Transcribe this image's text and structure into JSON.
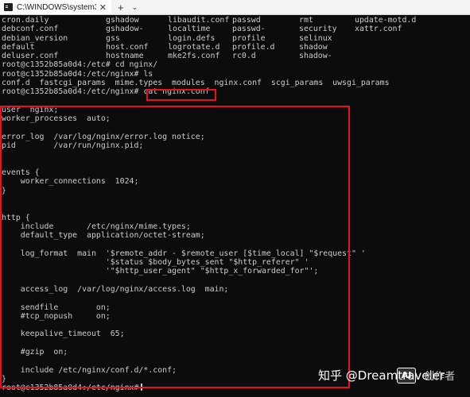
{
  "window": {
    "tab_title": "C:\\WINDOWS\\system32\\cmd.e",
    "close_glyph": "✕",
    "add_glyph": "+",
    "dropdown_glyph": "⌄",
    "icon": "terminal-icon"
  },
  "ls_rows": [
    [
      "cron.daily",
      "gshadow",
      "libaudit.conf",
      "passwd",
      "rmt",
      "update-motd.d"
    ],
    [
      "debconf.conf",
      "gshadow-",
      "localtime",
      "passwd-",
      "security",
      "xattr.conf"
    ],
    [
      "debian_version",
      "gss",
      "login.defs",
      "profile",
      "selinux",
      ""
    ],
    [
      "default",
      "host.conf",
      "logrotate.d",
      "profile.d",
      "shadow",
      ""
    ],
    [
      "deluser.conf",
      "hostname",
      "mke2fs.conf",
      "rc0.d",
      "shadow-",
      ""
    ]
  ],
  "prompt_lines": {
    "cd_cmd": "root@c1352b85a0d4:/etc# cd nginx/",
    "ls_cmd": "root@c1352b85a0d4:/etc/nginx# ls",
    "ls_output": "conf.d  fastcgi_params  mime.types  modules  nginx.conf  scgi_params  uwsgi_params",
    "cat_prefix": "root@c1352b85a0d4:/etc/nginx# cat ",
    "cat_file": "nginx.conf",
    "final_prompt": "root@c1352b85a0d4:/etc/nginx#"
  },
  "conf_lines": [
    "",
    "user  nginx;",
    "worker_processes  auto;",
    "",
    "error_log  /var/log/nginx/error.log notice;",
    "pid        /var/run/nginx.pid;",
    "",
    "",
    "events {",
    "    worker_connections  1024;",
    "}",
    "",
    "",
    "http {",
    "    include       /etc/nginx/mime.types;",
    "    default_type  application/octet-stream;",
    "",
    "    log_format  main  '$remote_addr - $remote_user [$time_local] \"$request\" '",
    "                      '$status $body_bytes_sent \"$http_referer\" '",
    "                      '\"$http_user_agent\" \"$http_x_forwarded_for\"';",
    "",
    "    access_log  /var/log/nginx/access.log  main;",
    "",
    "    sendfile        on;",
    "    #tcp_nopush     on;",
    "",
    "    keepalive_timeout  65;",
    "",
    "    #gzip  on;",
    "",
    "    include /etc/nginx/conf.d/*.conf;",
    "}"
  ],
  "watermark": {
    "text": "知乎 @Dreamtraveler",
    "logo": "AI",
    "tail": "创作者"
  },
  "colors": {
    "terminal_bg": "#0c0c0c",
    "terminal_fg": "#cccccc",
    "highlight_border": "#e81123"
  }
}
